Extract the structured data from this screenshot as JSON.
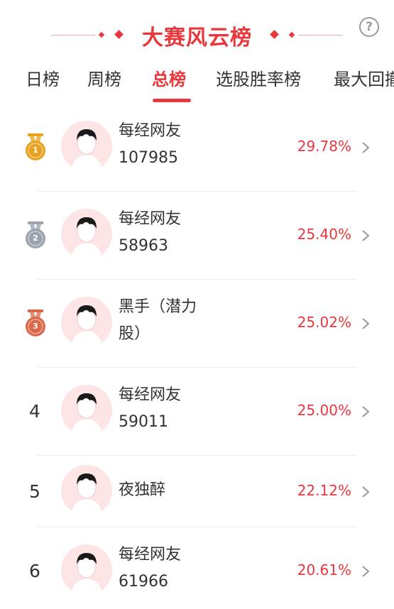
{
  "header": {
    "title": "大赛风云榜",
    "help_label": "?"
  },
  "tabs": [
    {
      "label": "日榜"
    },
    {
      "label": "周榜"
    },
    {
      "label": "总榜"
    },
    {
      "label": "选股胜率榜"
    },
    {
      "label": "最大回撤"
    }
  ],
  "active_tab": "总榜",
  "rows": [
    {
      "rank": "1",
      "medal": "gold-medal-icon",
      "name_line1": "每经网友",
      "name_line2": "107985",
      "percent": "29.78%"
    },
    {
      "rank": "2",
      "medal": "silver-medal-icon",
      "name_line1": "每经网友",
      "name_line2": "58963",
      "percent": "25.40%"
    },
    {
      "rank": "3",
      "medal": "bronze-medal-icon",
      "name_line1": "黑手（潜力",
      "name_line2": "股）",
      "percent": "25.02%"
    },
    {
      "rank": "4",
      "medal": "",
      "name_line1": "每经网友",
      "name_line2": "59011",
      "percent": "25.00%"
    },
    {
      "rank": "5",
      "medal": "",
      "name_line1": "夜独醉",
      "name_line2": "",
      "percent": "22.12%"
    },
    {
      "rank": "6",
      "medal": "",
      "name_line1": "每经网友",
      "name_line2": "61966",
      "percent": "20.61%"
    }
  ],
  "colors": {
    "accent": "#e8383d",
    "gold": "#e8a21f",
    "silver": "#9aa3ad",
    "bronze": "#d9694a",
    "avatar_bg": "#fde5e6"
  }
}
